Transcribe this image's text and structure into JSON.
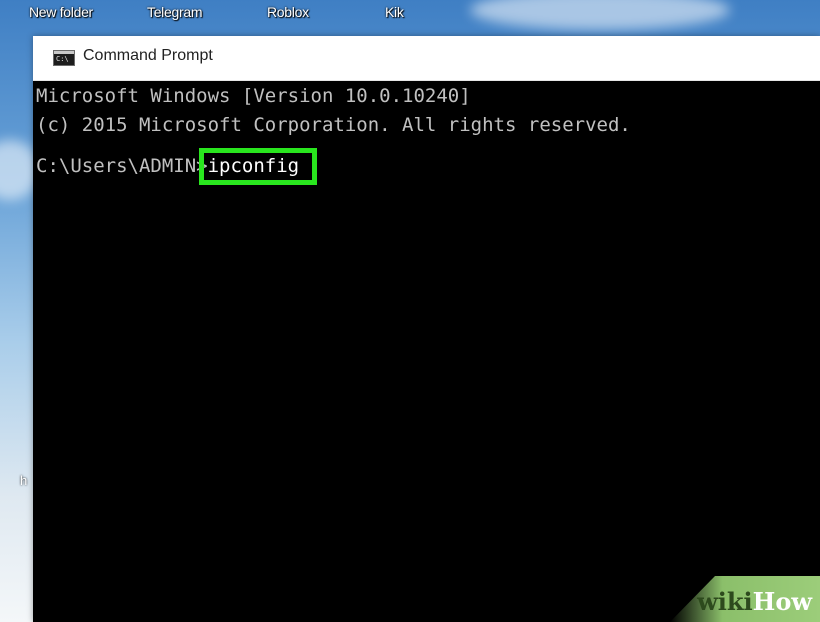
{
  "desktop": {
    "icons": [
      {
        "label": "New folder"
      },
      {
        "label": "Telegram"
      },
      {
        "label": "Roblox"
      },
      {
        "label": "Kik"
      }
    ],
    "side_glyph": "h"
  },
  "window": {
    "title": "Command Prompt",
    "icon": "cmd-window-icon",
    "icon_text": "C:\\"
  },
  "console": {
    "lines": [
      "Microsoft Windows [Version 10.0.10240]",
      "(c) 2015 Microsoft Corporation. All rights reserved."
    ],
    "prompt": "C:\\Users\\ADMIN>",
    "command": "ipconfig"
  },
  "highlight_color": "#29e61e",
  "watermark": {
    "wiki": "wiki",
    "how": "How"
  }
}
